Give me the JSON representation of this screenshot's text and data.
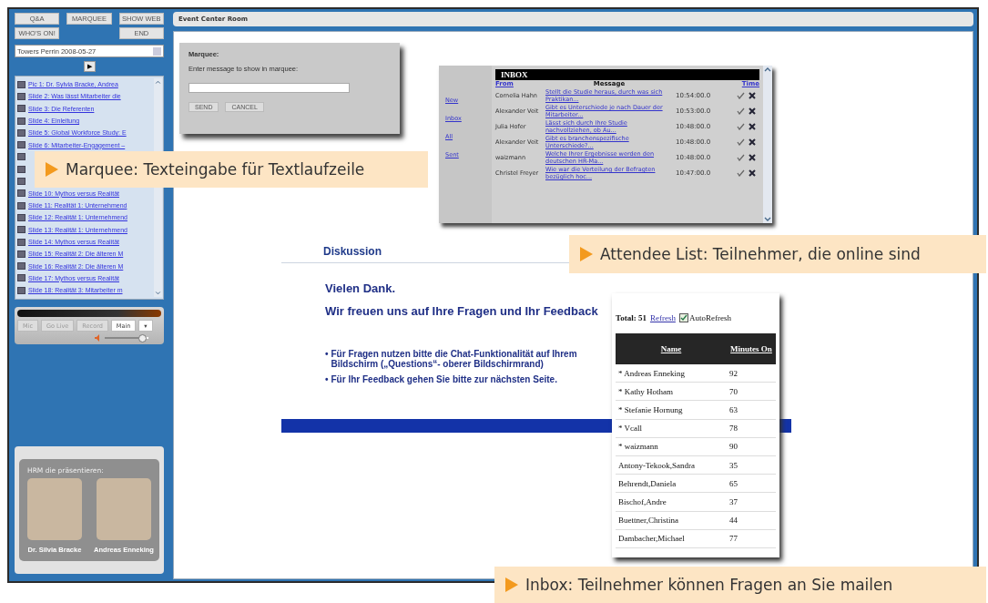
{
  "sidebar": {
    "buttons": [
      {
        "label": "Q&A"
      },
      {
        "label": "MARQUEE"
      },
      {
        "label": "SHOW WEB"
      },
      {
        "label": "WHO'S ON!"
      },
      {
        "label": "END"
      }
    ],
    "presentation_select": {
      "value": "Towers Perrin 2008-05-27"
    },
    "play_button": {
      "label": "▶"
    },
    "slides": [
      {
        "kind": "link",
        "label": "Pic 1: Dr. Sylvia Bracke, Andrea"
      },
      {
        "kind": "link",
        "label": "Slide 2: Was lässt Mitarbeiter die"
      },
      {
        "kind": "link",
        "label": "Slide 3: Die Referenten"
      },
      {
        "kind": "link",
        "label": "Slide 4: Einleitung"
      },
      {
        "kind": "link",
        "label": "Slide 5: Global Workforce Study: E"
      },
      {
        "kind": "link",
        "label": "Slide 6: Mitarbeiter-Engagement –"
      },
      {
        "kind": "covered"
      },
      {
        "kind": "covered"
      },
      {
        "kind": "covered"
      },
      {
        "kind": "link",
        "label": "Slide 10: Mythos versus Realität"
      },
      {
        "kind": "link",
        "label": "Slide 11: Realität 1: Unternehmend"
      },
      {
        "kind": "link",
        "label": "Slide 12: Realität 1: Unternehmend"
      },
      {
        "kind": "link",
        "label": "Slide 13: Realität 1: Unternehmend"
      },
      {
        "kind": "link",
        "label": "Slide 14: Mythos versus Realität"
      },
      {
        "kind": "link",
        "label": "Slide 15: Realität 2: Die älteren M"
      },
      {
        "kind": "link",
        "label": "Slide 16: Realität 2: Die älteren M"
      },
      {
        "kind": "link",
        "label": "Slide 17: Mythos versus Realität"
      },
      {
        "kind": "link",
        "label": "Slide 18: Realität 3: Mitarbeiter m"
      }
    ],
    "media": {
      "buttons": [
        {
          "label": "Mic",
          "active": false
        },
        {
          "label": "Go Live",
          "active": false
        },
        {
          "label": "Record",
          "active": false
        },
        {
          "label": "Main",
          "active": true
        },
        {
          "label": "▾",
          "active": true
        }
      ],
      "volume": {
        "level": 0.85
      }
    },
    "presenters": {
      "caption": "HRM die präsentieren:",
      "people": [
        {
          "name": "Dr. Silvia Bracke"
        },
        {
          "name": "Andreas Enneking"
        }
      ]
    }
  },
  "main": {
    "title": "Event Center Room",
    "slide": {
      "heading": "Diskussion",
      "lines": [
        "Vielen Dank.",
        "Wir freuen uns auf Ihre Fragen und Ihr Feedback"
      ],
      "bullets": [
        "Für Fragen nutzen bitte die Chat-Funktionalität auf Ihrem Bildschirm („Questions“- oberer Bildschirmrand)",
        "Für Ihr Feedback gehen Sie bitte zur nächsten Seite."
      ],
      "bullet_mark": "•"
    }
  },
  "marquee_dialog": {
    "title": "Marquee:",
    "prompt": "Enter message to show in marquee:",
    "buttons": [
      "SEND",
      "CANCEL"
    ]
  },
  "inbox": {
    "nav": [
      "New",
      "Inbox",
      "All",
      "Sent"
    ],
    "title": "INBOX",
    "columns": [
      "From",
      "Message",
      "Time"
    ],
    "rows": [
      {
        "from": "Cornelia Hahn",
        "message": "Stellt die Studie heraus, durch was sich Praktikan...",
        "time": "10:54:00.0"
      },
      {
        "from": "Alexander Veit",
        "message": "Gibt es Unterschiede je nach Dauer der Mitarbeiter...",
        "time": "10:53:00.0"
      },
      {
        "from": "Julia Hofer",
        "message": "Lässt sich durch Ihre Studie nachvollziehen, ob Au...",
        "time": "10:48:00.0"
      },
      {
        "from": "Alexander Veit",
        "message": "Gibt es branchenspezifische Unterschiede?...",
        "time": "10:48:00.0"
      },
      {
        "from": "waizmann",
        "message": "Welche Ihrer Ergebnisse werden den deutschen HR-Ma...",
        "time": "10:48:00.0"
      },
      {
        "from": "Christel Freyer",
        "message": "Wie war die Verteilung der Befragten bezüglich hoc...",
        "time": "10:47:00.0"
      }
    ]
  },
  "attendees": {
    "total": "Total: 51",
    "refresh": "Refresh",
    "auto_refresh": {
      "label": "AutoRefresh",
      "checked": true
    },
    "columns": [
      "Name",
      "Minutes On"
    ],
    "rows": [
      {
        "name": "* Andreas Enneking",
        "minutes": "92"
      },
      {
        "name": "* Kathy Hotham",
        "minutes": "70"
      },
      {
        "name": "* Stefanie Hornung",
        "minutes": "63"
      },
      {
        "name": "* Vcall",
        "minutes": "78"
      },
      {
        "name": "* waizmann",
        "minutes": "90"
      },
      {
        "name": "Antony-Tekook,Sandra",
        "minutes": "35"
      },
      {
        "name": "Behrendt,Daniela",
        "minutes": "65"
      },
      {
        "name": "Bischof,Andre",
        "minutes": "37"
      },
      {
        "name": "Buettner,Christina",
        "minutes": "44"
      },
      {
        "name": "Dambacher,Michael",
        "minutes": "77"
      }
    ]
  },
  "callouts": [
    {
      "kind": "marquee",
      "text": "Marquee: Texteingabe für Textlaufzeile"
    },
    {
      "kind": "attendees",
      "text": "Attendee List: Teilnehmer, die online sind"
    },
    {
      "kind": "inbox",
      "text": "Inbox: Teilnehmer können Fragen an Sie mailen"
    }
  ]
}
